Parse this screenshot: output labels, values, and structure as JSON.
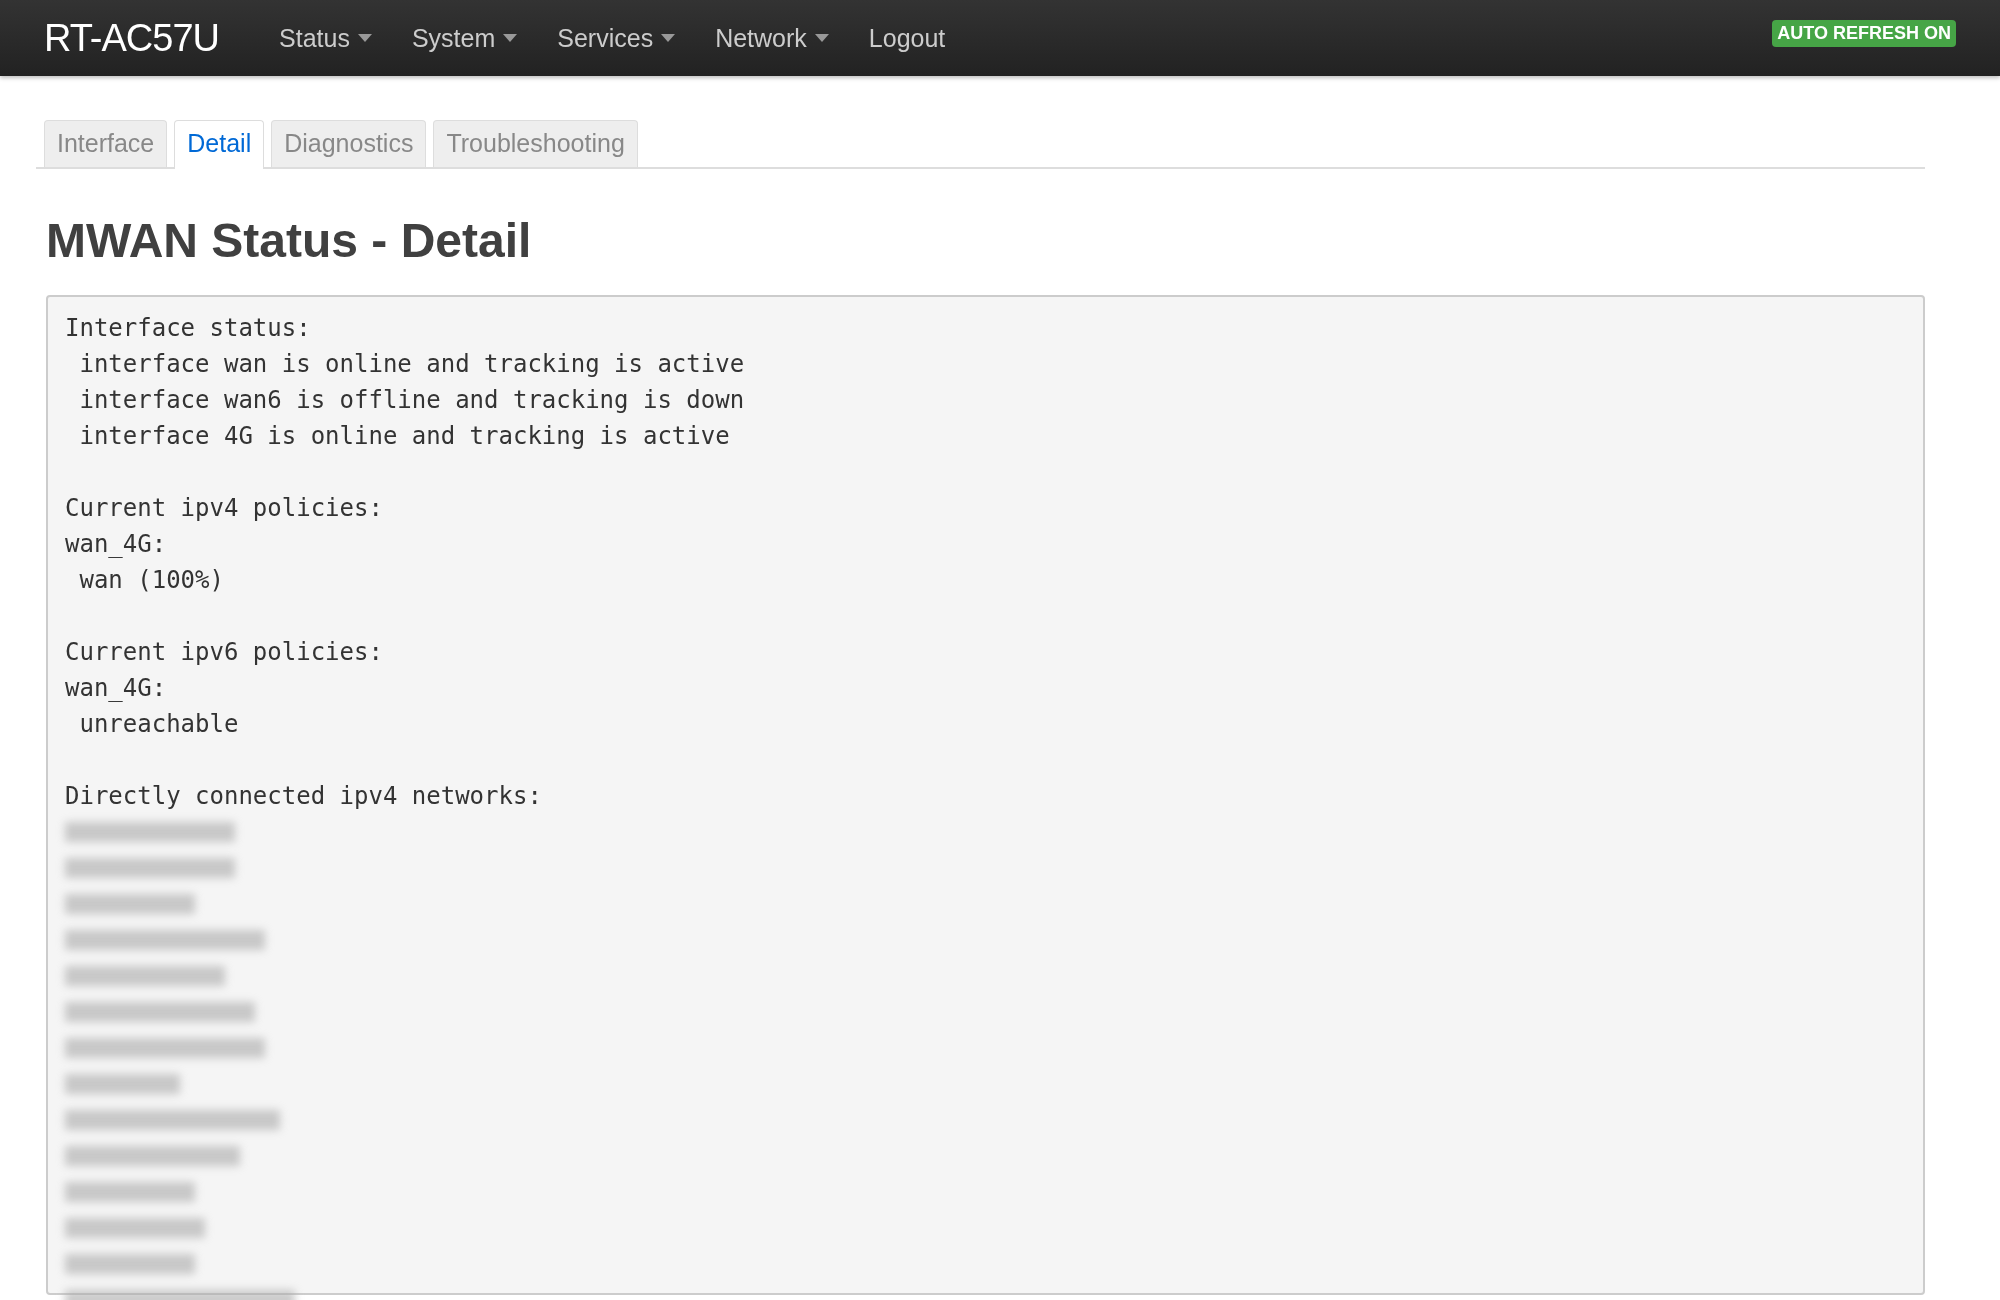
{
  "navbar": {
    "brand": "RT-AC57U",
    "menu": [
      {
        "label": "Status",
        "dropdown": true
      },
      {
        "label": "System",
        "dropdown": true
      },
      {
        "label": "Services",
        "dropdown": true
      },
      {
        "label": "Network",
        "dropdown": true
      },
      {
        "label": "Logout",
        "dropdown": false
      }
    ],
    "badge": "AUTO REFRESH ON"
  },
  "tabs": [
    {
      "label": "Interface",
      "selected": false
    },
    {
      "label": "Detail",
      "selected": true
    },
    {
      "label": "Diagnostics",
      "selected": false
    },
    {
      "label": "Troubleshooting",
      "selected": false
    }
  ],
  "heading": "MWAN Status - Detail",
  "output": [
    {
      "kind": "text",
      "text": "Interface status:"
    },
    {
      "kind": "text",
      "text": " interface wan is online and tracking is active"
    },
    {
      "kind": "text",
      "text": " interface wan6 is offline and tracking is down"
    },
    {
      "kind": "text",
      "text": " interface 4G is online and tracking is active"
    },
    {
      "kind": "blank"
    },
    {
      "kind": "text",
      "text": "Current ipv4 policies:"
    },
    {
      "kind": "text",
      "text": "wan_4G:"
    },
    {
      "kind": "text",
      "text": " wan (100%)"
    },
    {
      "kind": "blank"
    },
    {
      "kind": "text",
      "text": "Current ipv6 policies:"
    },
    {
      "kind": "text",
      "text": "wan_4G:"
    },
    {
      "kind": "text",
      "text": " unreachable"
    },
    {
      "kind": "blank"
    },
    {
      "kind": "text",
      "text": "Directly connected ipv4 networks:"
    },
    {
      "kind": "blurred"
    },
    {
      "kind": "blurred"
    },
    {
      "kind": "blurred"
    },
    {
      "kind": "blurred"
    },
    {
      "kind": "blurred"
    },
    {
      "kind": "blurred"
    },
    {
      "kind": "blurred"
    },
    {
      "kind": "blurred"
    },
    {
      "kind": "blurred"
    },
    {
      "kind": "blurred"
    },
    {
      "kind": "blurred"
    },
    {
      "kind": "blurred"
    },
    {
      "kind": "blurred"
    },
    {
      "kind": "blurred"
    }
  ]
}
